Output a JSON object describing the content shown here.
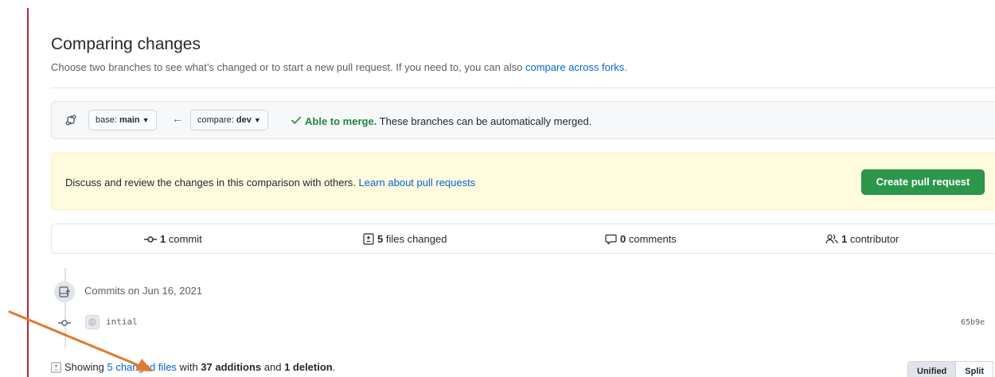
{
  "header": {
    "title": "Comparing changes",
    "subtitle_text": "Choose two branches to see what’s changed or to start a new pull request. If you need to, you can also ",
    "subtitle_link": "compare across forks",
    "subtitle_end": "."
  },
  "range": {
    "base_prefix": "base: ",
    "base_branch": "main",
    "compare_prefix": "compare: ",
    "compare_branch": "dev",
    "arrow": "←",
    "merge_ok": "Able to merge.",
    "merge_detail": " These branches can be automatically merged."
  },
  "flash": {
    "text": "Discuss and review the changes in this comparison with others. ",
    "link": "Learn about pull requests",
    "create_button": "Create pull request",
    "button_color": "#2c974b"
  },
  "numbers": {
    "commits_count": "1",
    "commits_label": " commit",
    "files_count": "5",
    "files_label": " files changed",
    "comments_count": "0",
    "comments_label": " comments",
    "contributors_count": "1",
    "contributors_label": " contributor"
  },
  "commits": {
    "group_label": "Commits on Jun 16, 2021",
    "items": [
      {
        "message": "intial",
        "sha": "65b9e"
      }
    ]
  },
  "toc": {
    "prefix": "Showing ",
    "files_link": "5 changed files",
    "with": " with ",
    "additions": "37 additions",
    "and": " and ",
    "deletions": "1 deletion",
    "end": "."
  },
  "diff_view": {
    "unified_label": "Unified",
    "split_label": "Split"
  },
  "colors": {
    "accent_link": "#0366d6",
    "success": "#22863a",
    "annotation_arrow": "#e07b2d",
    "left_rule": "#b3263a"
  },
  "icons": {
    "compare": "git-compare-icon",
    "check": "check-icon",
    "commit": "git-commit-icon",
    "file_diff": "file-diff-icon",
    "comment": "comment-icon",
    "people": "people-icon",
    "repo_push": "repo-push-icon"
  }
}
